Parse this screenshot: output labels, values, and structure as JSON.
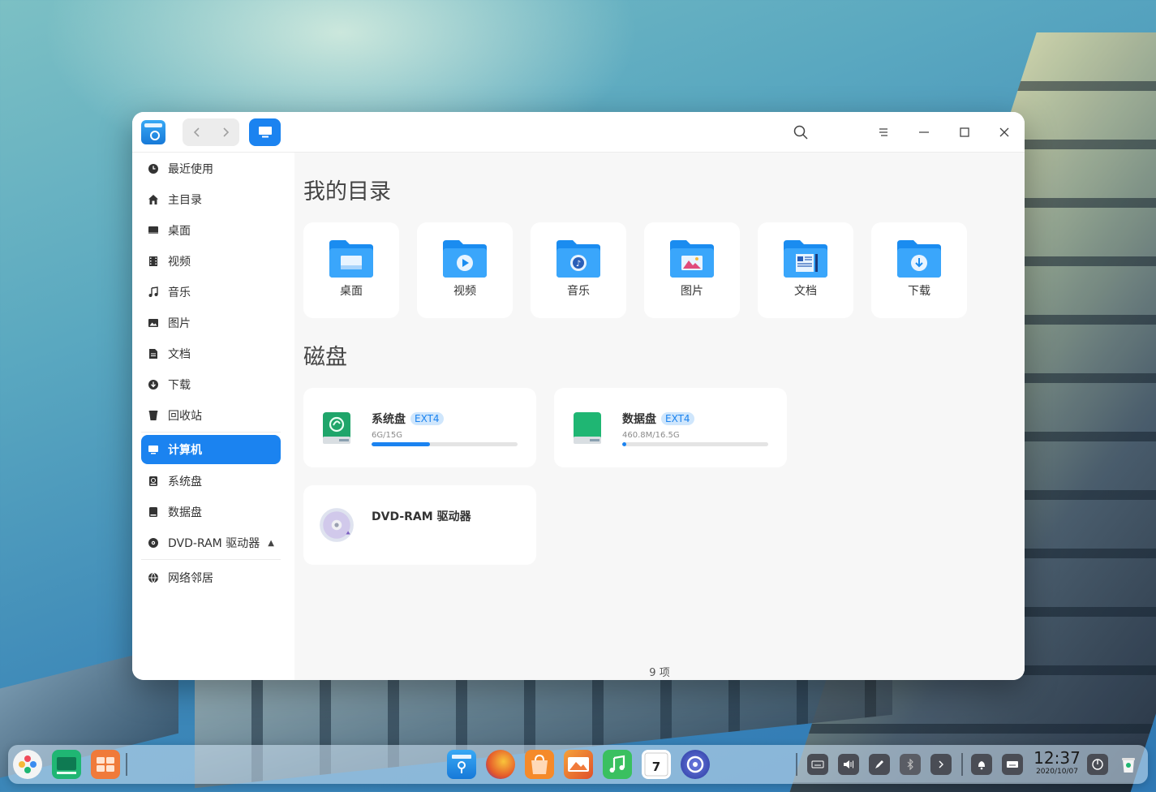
{
  "sidebar": {
    "items": [
      {
        "label": "最近使用",
        "icon": "clock-icon"
      },
      {
        "label": "主目录",
        "icon": "home-icon"
      },
      {
        "label": "桌面",
        "icon": "desktop-icon"
      },
      {
        "label": "视频",
        "icon": "video-icon"
      },
      {
        "label": "音乐",
        "icon": "music-icon"
      },
      {
        "label": "图片",
        "icon": "picture-icon"
      },
      {
        "label": "文档",
        "icon": "document-icon"
      },
      {
        "label": "下载",
        "icon": "download-icon"
      },
      {
        "label": "回收站",
        "icon": "trash-icon"
      },
      {
        "label": "计算机",
        "icon": "computer-icon",
        "active": true
      },
      {
        "label": "系统盘",
        "icon": "disk-icon"
      },
      {
        "label": "数据盘",
        "icon": "disk-icon"
      },
      {
        "label": "DVD-RAM 驱动器",
        "icon": "optical-disc-icon",
        "eject": "eject-icon"
      },
      {
        "label": "网络邻居",
        "icon": "network-icon"
      }
    ]
  },
  "main": {
    "my_dirs_title": "我的目录",
    "folders": [
      {
        "label": "桌面",
        "icon": "desktop-folder-icon"
      },
      {
        "label": "视频",
        "icon": "video-folder-icon"
      },
      {
        "label": "音乐",
        "icon": "music-folder-icon"
      },
      {
        "label": "图片",
        "icon": "pictures-folder-icon"
      },
      {
        "label": "文档",
        "icon": "documents-folder-icon"
      },
      {
        "label": "下载",
        "icon": "downloads-folder-icon"
      }
    ],
    "disks_title": "磁盘",
    "disks": [
      {
        "name": "系统盘",
        "fs": "EXT4",
        "usage": "6G/15G",
        "fill": 0.4,
        "color": "#1fa56a"
      },
      {
        "name": "数据盘",
        "fs": "EXT4",
        "usage": "460.8M/16.5G",
        "fill": 0.028,
        "color": "#1fb673"
      }
    ],
    "optical": {
      "name": "DVD-RAM 驱动器"
    },
    "status": "9 项"
  },
  "titlebar": {
    "back_icon": "chevron-left-icon",
    "forward_icon": "chevron-right-icon",
    "crumb_icon": "computer-icon"
  },
  "dock": {
    "clock": {
      "time": "12:37",
      "date": "2020/10/07"
    }
  },
  "colors": {
    "accent": "#1b83f0"
  }
}
